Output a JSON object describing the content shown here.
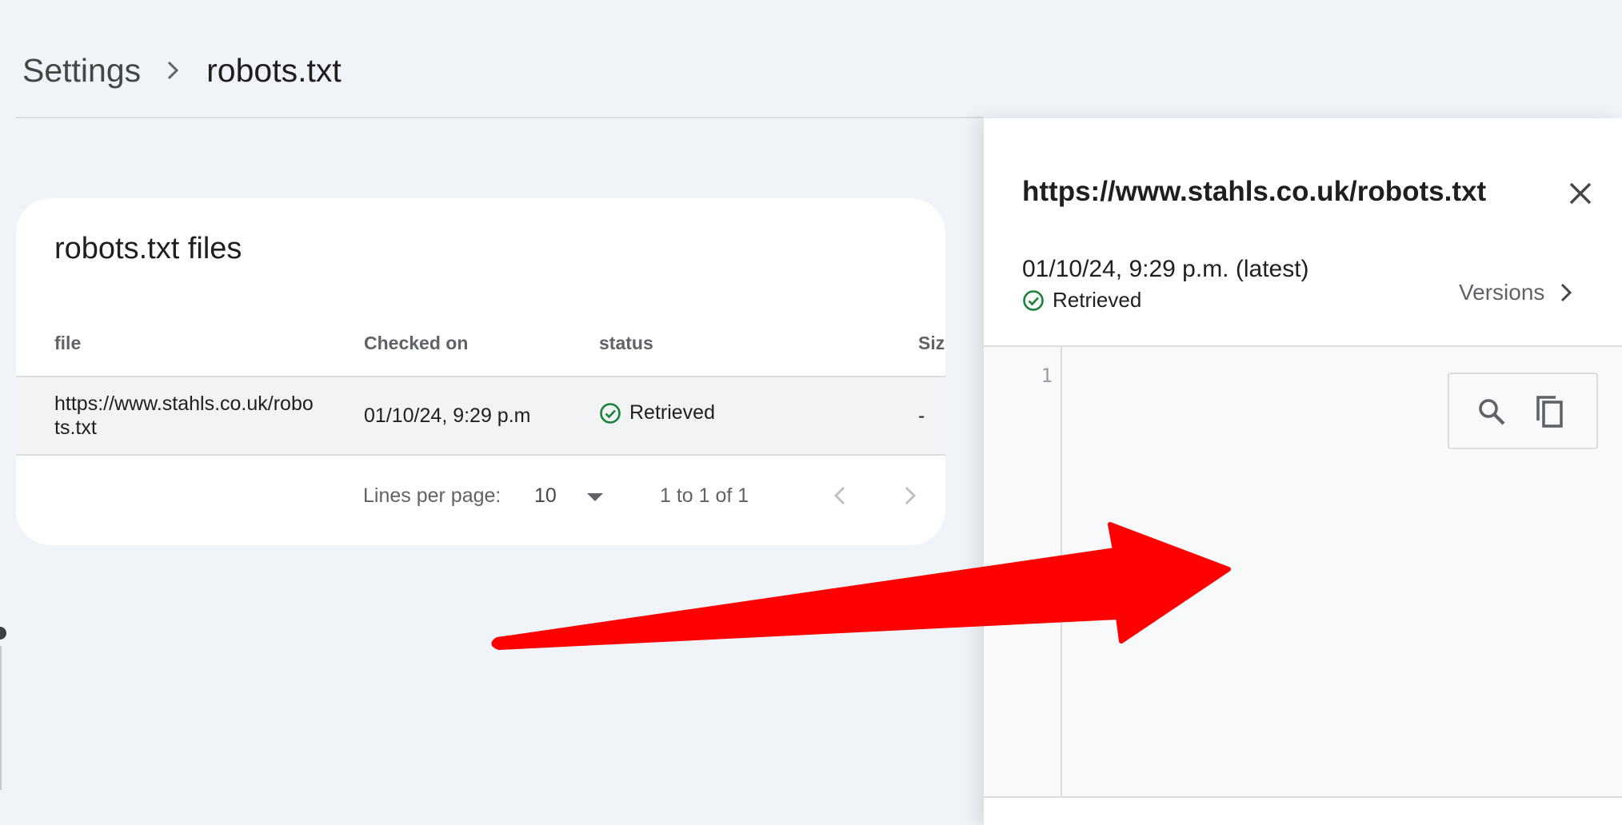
{
  "breadcrumb": {
    "root": "Settings",
    "current": "robots.txt"
  },
  "card": {
    "title": "robots.txt files",
    "columns": [
      "file",
      "Checked on",
      "status",
      "Siz"
    ],
    "rows": [
      {
        "file": "https://www.stahls.co.uk/robots.txt",
        "checked_on": "01/10/24, 9:29 p.m",
        "status": "Retrieved",
        "size": "-"
      }
    ],
    "pagination": {
      "label": "Lines per page:",
      "per_page": "10",
      "range": "1 to 1 of 1"
    }
  },
  "panel": {
    "title": "https://www.stahls.co.uk/robots.txt",
    "date": "01/10/24, 9:29 p.m. (latest)",
    "status": "Retrieved",
    "versions_label": "Versions",
    "editor": {
      "line_numbers": [
        "1"
      ]
    }
  },
  "icons": {
    "breadcrumb_separator": "chevron-right-icon",
    "status": "check-circle-icon",
    "close": "close-icon",
    "search": "search-icon",
    "copy": "copy-icon",
    "dropdown": "arrow-drop-down-icon",
    "prev": "chevron-left-icon",
    "next": "chevron-right-icon"
  },
  "colors": {
    "page_background": "#f0f4f9",
    "success_green": "#188038",
    "annotation_arrow": "#ff0000"
  }
}
